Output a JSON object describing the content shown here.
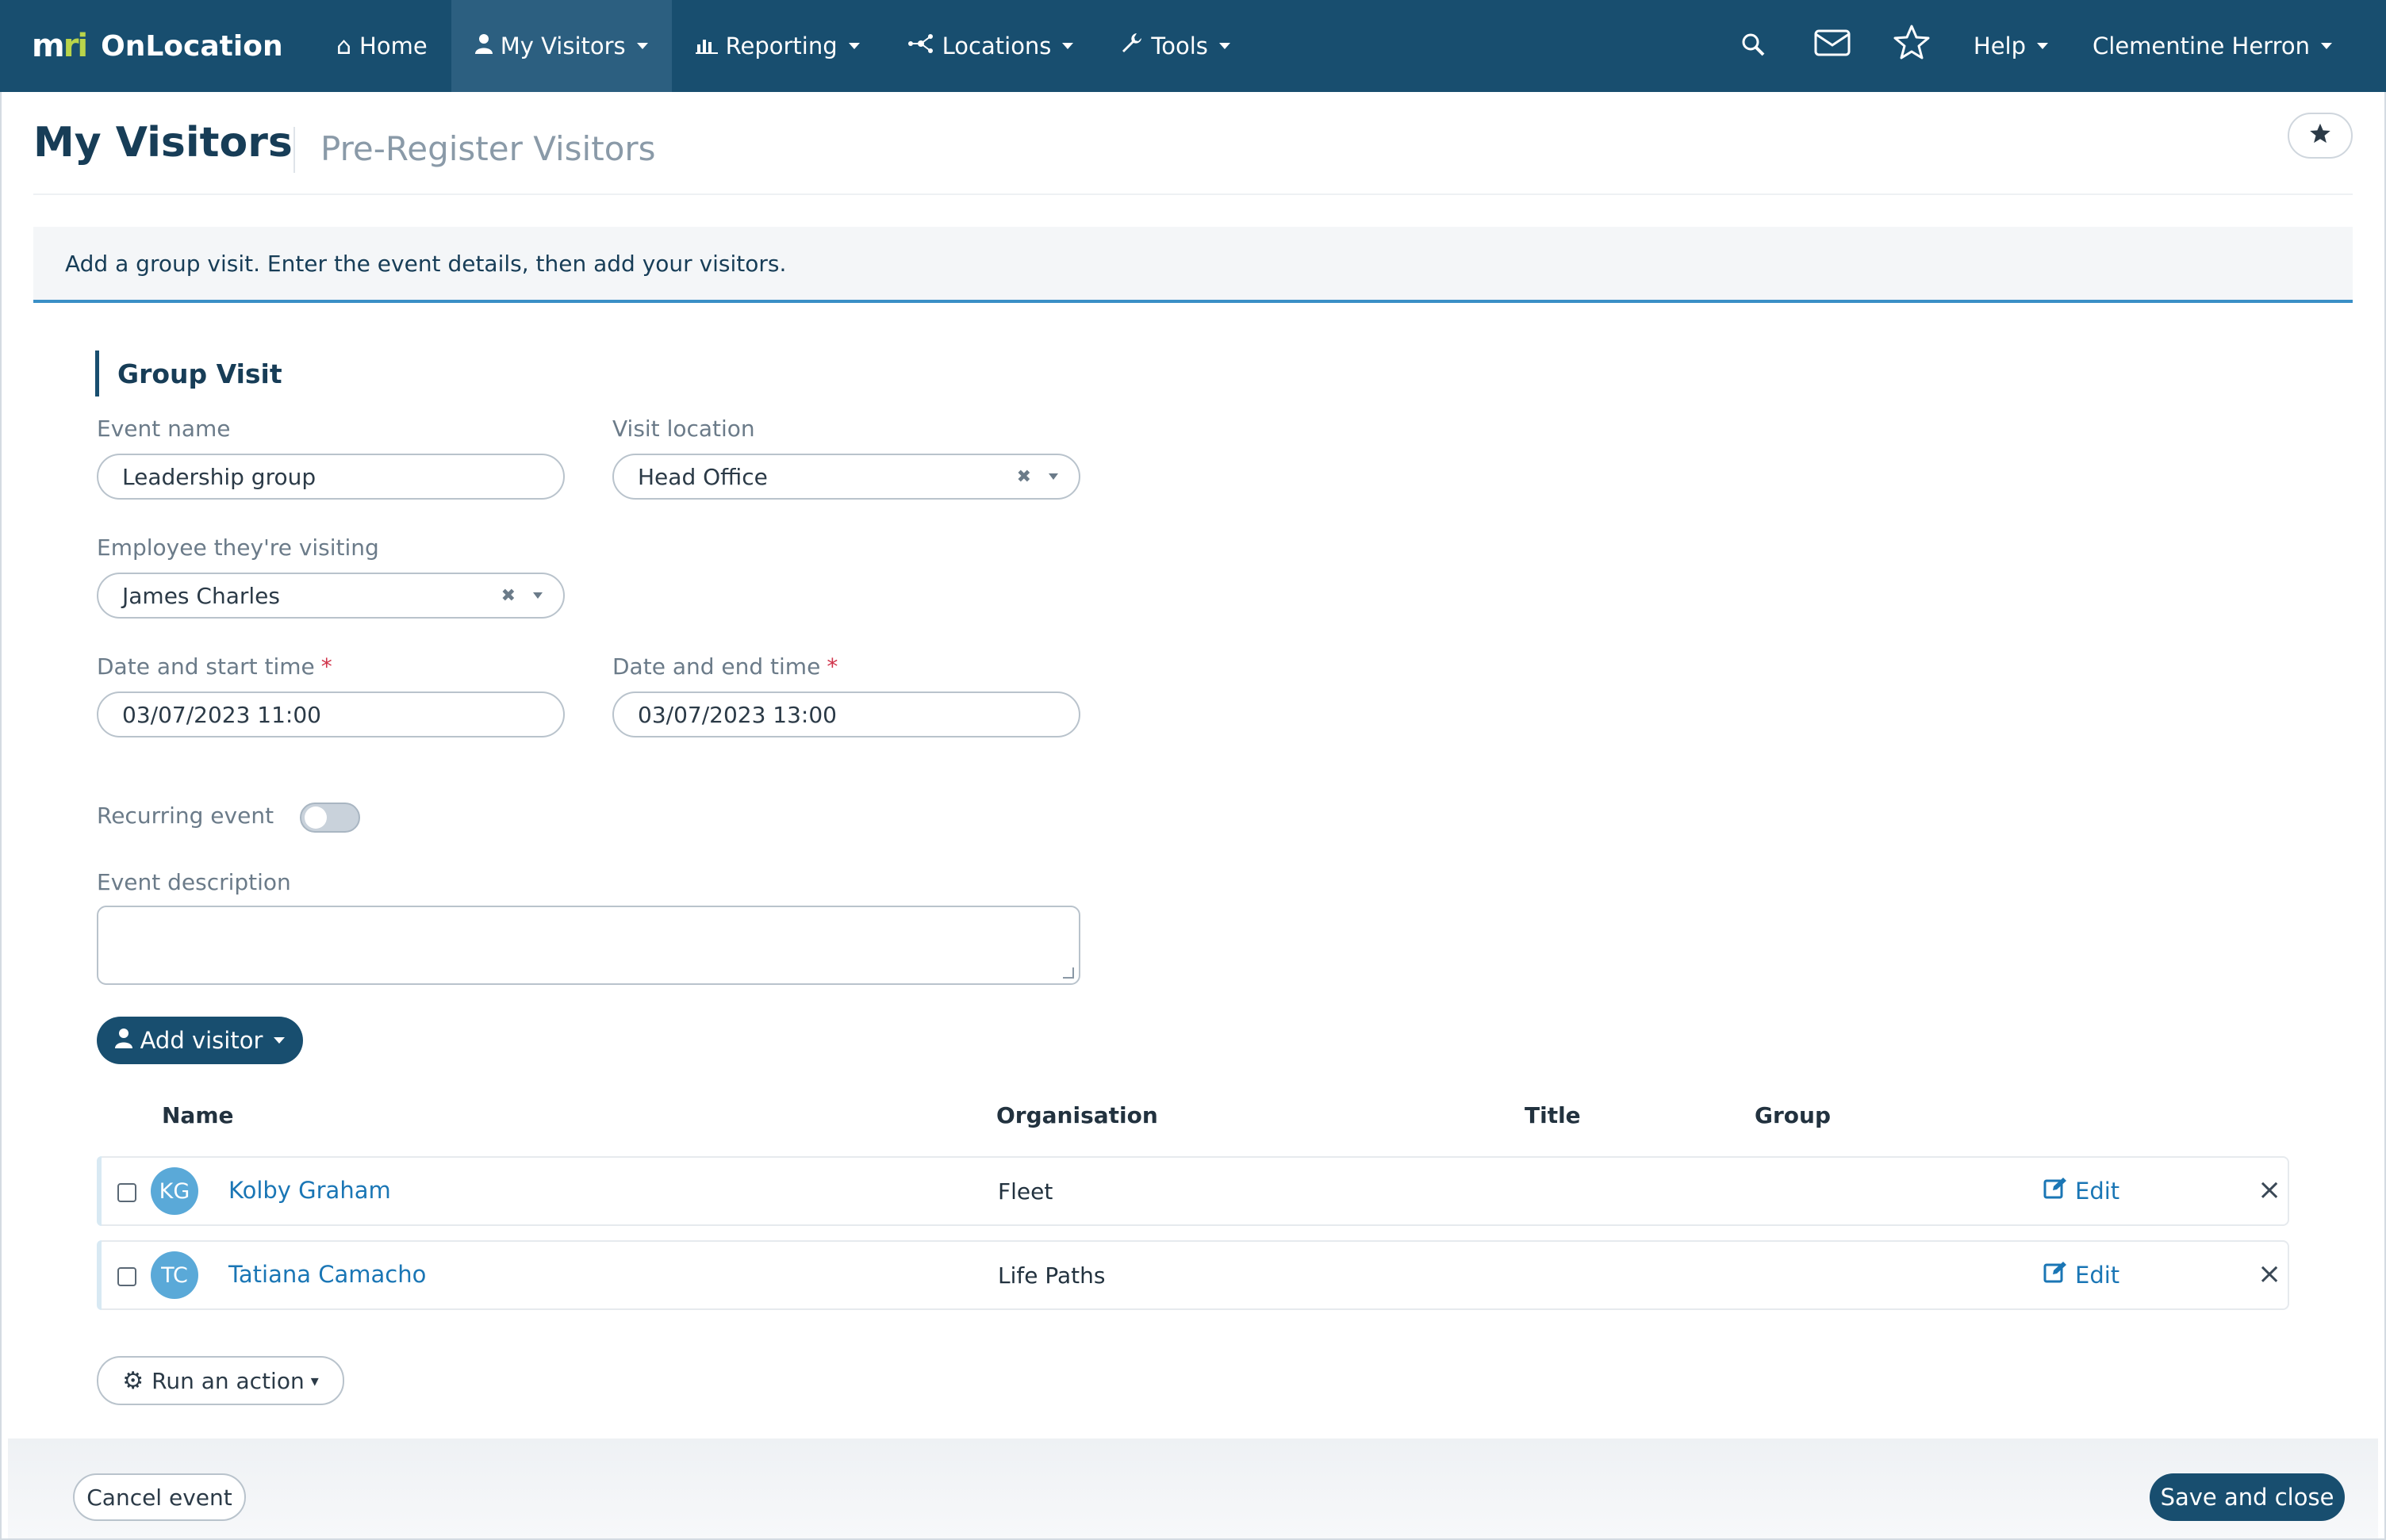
{
  "nav": {
    "brand_mark_a": "m",
    "brand_mark_b": "ri",
    "brand_name": "OnLocation",
    "items": [
      {
        "label": "Home",
        "icon": "home-icon"
      },
      {
        "label": "My Visitors",
        "icon": "user-icon"
      },
      {
        "label": "Reporting",
        "icon": "bar-chart-icon"
      },
      {
        "label": "Locations",
        "icon": "network-icon"
      },
      {
        "label": "Tools",
        "icon": "wrench-icon"
      }
    ],
    "help_label": "Help",
    "user_name": "Clementine Herron"
  },
  "header": {
    "title": "My Visitors",
    "subtitle": "Pre-Register Visitors"
  },
  "banner": {
    "text": "Add a group visit. Enter the event details, then add your visitors."
  },
  "form": {
    "section_title": "Group Visit",
    "event_name_label": "Event name",
    "event_name_value": "Leadership group",
    "visit_location_label": "Visit location",
    "visit_location_value": "Head Office",
    "employee_label": "Employee they're visiting",
    "employee_value": "James Charles",
    "start_label": "Date and start time",
    "start_value": "03/07/2023 11:00",
    "end_label": "Date and end time",
    "end_value": "03/07/2023 13:00",
    "required_mark": "*",
    "recurring_label": "Recurring event",
    "recurring_on": false,
    "description_label": "Event description",
    "description_value": ""
  },
  "visitors": {
    "add_label": "Add visitor",
    "columns": [
      "Name",
      "Organisation",
      "Title",
      "Group"
    ],
    "rows": [
      {
        "initials": "KG",
        "name": "Kolby Graham",
        "organisation": "Fleet",
        "title": "",
        "group": "",
        "edit_label": "Edit"
      },
      {
        "initials": "TC",
        "name": "Tatiana Camacho",
        "organisation": "Life Paths",
        "title": "",
        "group": "",
        "edit_label": "Edit"
      }
    ],
    "run_action_label": "Run an action"
  },
  "footer": {
    "cancel_label": "Cancel event",
    "save_label": "Save and close"
  },
  "colors": {
    "nav_bg": "#184e6f",
    "accent": "#3a8fc6",
    "link": "#1a76b5",
    "avatar": "#5aa9d8",
    "required": "#d0344b"
  }
}
